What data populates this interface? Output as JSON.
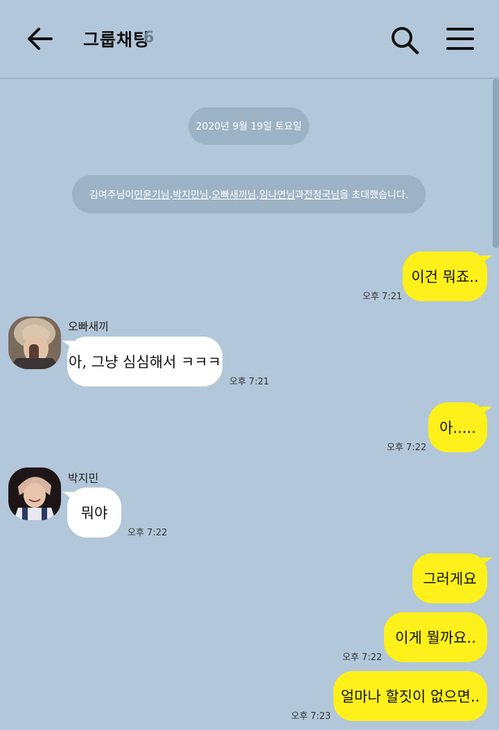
{
  "header": {
    "title": "그룹채팅",
    "member_count": "6"
  },
  "date_divider": "2020년 9월 19일 토요일",
  "notice": {
    "prefix": "김여주님이 ",
    "names": [
      "민윤기님",
      "박지민님",
      "오빠새끼님",
      "임나연님",
      "전정국님"
    ],
    "separator": ", ",
    "joiner": "과 ",
    "suffix": "을 초대했습니다."
  },
  "messages": [
    {
      "text": "이건 뭐죠..",
      "time": "오후 7:21"
    },
    {
      "sender": "오빠새끼",
      "text": "아, 그냥 심심해서 ㅋㅋㅋ",
      "time": "오후 7:21"
    },
    {
      "text": "아.....",
      "time": "오후 7:22"
    },
    {
      "sender": "박지민",
      "text": "뭐야",
      "time": "오후 7:22"
    },
    {
      "text": "그러게요"
    },
    {
      "text": "이게 뭘까요..",
      "time": "오후 7:22"
    },
    {
      "text": "얼마나 할짓이 없으면..",
      "time": "오후 7:23"
    }
  ],
  "colors": {
    "background": "#b2c7d9",
    "my_bubble": "#fef01b",
    "their_bubble": "#ffffff",
    "system_pill": "#9db3c5"
  },
  "icons": [
    "back-arrow-icon",
    "search-icon",
    "menu-icon"
  ]
}
